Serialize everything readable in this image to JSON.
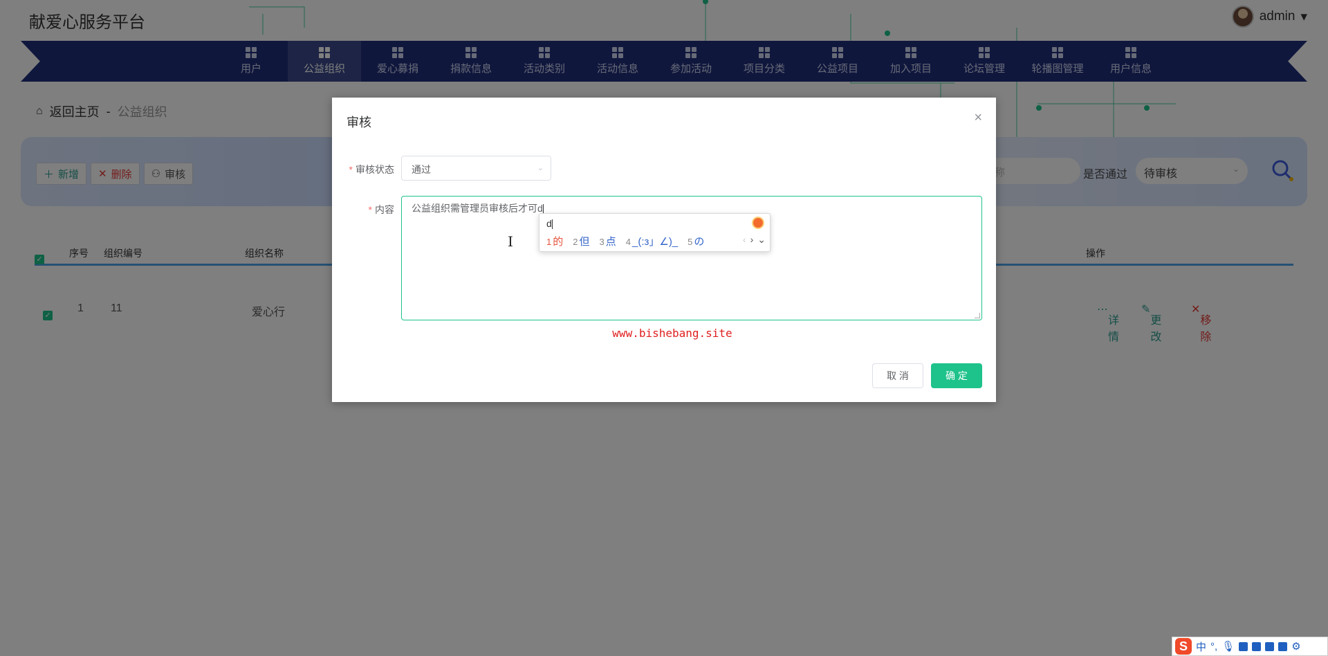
{
  "site": {
    "title": "献爱心服务平台",
    "user": "admin"
  },
  "nav": {
    "items": [
      {
        "label": "用户"
      },
      {
        "label": "公益组织",
        "active": true
      },
      {
        "label": "爱心募捐"
      },
      {
        "label": "捐款信息"
      },
      {
        "label": "活动类别"
      },
      {
        "label": "活动信息"
      },
      {
        "label": "参加活动"
      },
      {
        "label": "项目分类"
      },
      {
        "label": "公益项目"
      },
      {
        "label": "加入项目"
      },
      {
        "label": "论坛管理"
      },
      {
        "label": "轮播图管理"
      },
      {
        "label": "用户信息"
      }
    ]
  },
  "breadcrumb": {
    "home": "返回主页",
    "separator": "-",
    "current": "公益组织"
  },
  "toolbar": {
    "add": "新增",
    "delete": "删除",
    "audit": "审核"
  },
  "search": {
    "name_placeholder": "称",
    "approved_label": "是否通过",
    "approved_value": "待审核"
  },
  "table": {
    "headers": {
      "index": "序号",
      "org_no": "组织编号",
      "org_name": "组织名称",
      "actions": "操作"
    },
    "row": {
      "index": "1",
      "org_no": "11",
      "org_name": "爱心行",
      "detail": "详情",
      "edit": "更改",
      "remove": "移除"
    }
  },
  "dialog": {
    "title": "审核",
    "status_label": "审核状态",
    "status_value": "通过",
    "content_label": "内容",
    "content_value": "公益组织需管理员审核后才可d",
    "cancel": "取 消",
    "confirm": "确 定"
  },
  "watermark": "www.bishebang.site",
  "ime": {
    "composition": "d",
    "candidates": [
      {
        "num": "1",
        "text": "的"
      },
      {
        "num": "2",
        "text": "但"
      },
      {
        "num": "3",
        "text": "点"
      },
      {
        "num": "4",
        "text": "_(:з」∠)_"
      },
      {
        "num": "5",
        "text": "の"
      }
    ],
    "toolbar_lang": "中"
  },
  "colors": {
    "accent": "#1ec28b",
    "nav_bg": "#202f7a",
    "danger": "#e53935",
    "watermark": "#e02020"
  }
}
